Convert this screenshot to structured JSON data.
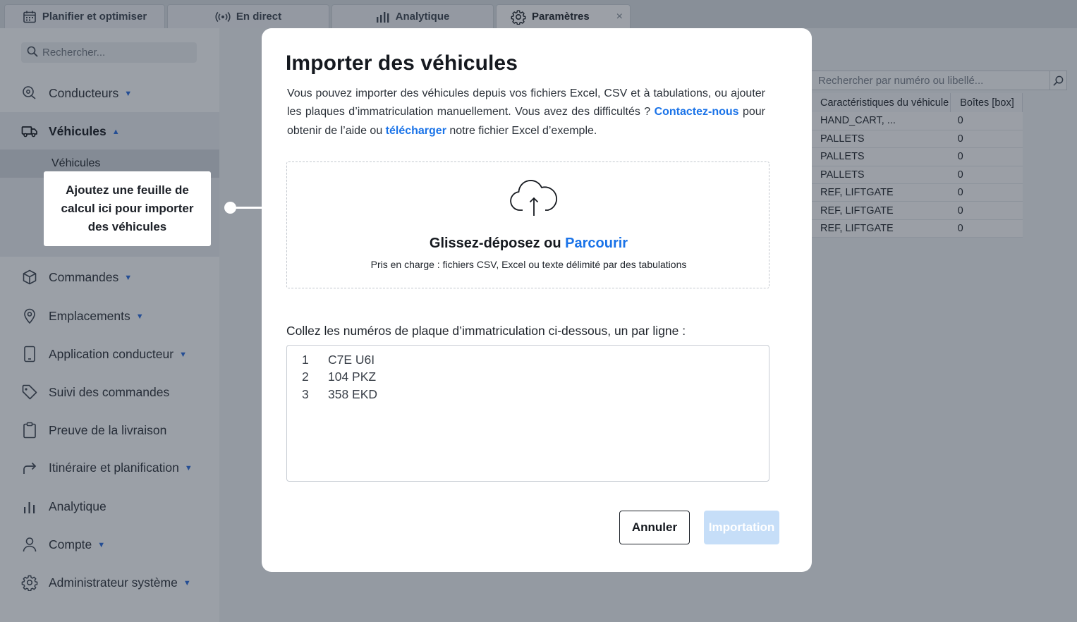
{
  "tabs": [
    {
      "label": "Planifier et optimiser",
      "icon": "calendar-icon"
    },
    {
      "label": "En direct",
      "icon": "live-broadcast-icon"
    },
    {
      "label": "Analytique",
      "icon": "bar-chart-icon"
    },
    {
      "label": "Paramètres",
      "icon": "gear-icon",
      "active": true,
      "close": "×"
    }
  ],
  "sidebar": {
    "search_placeholder": "Rechercher...",
    "items": [
      {
        "label": "Conducteurs",
        "icon": "drivers-icon",
        "caret": "▼"
      },
      {
        "label": "Véhicules",
        "icon": "truck-icon",
        "caret": "▲",
        "expanded": true
      },
      {
        "label": "Commandes",
        "icon": "box-icon",
        "caret": "▼"
      },
      {
        "label": "Emplacements",
        "icon": "location-pin-icon",
        "caret": "▼"
      },
      {
        "label": "Application conducteur",
        "icon": "phone-icon",
        "caret": "▼"
      },
      {
        "label": "Suivi des commandes",
        "icon": "tag-icon"
      },
      {
        "label": "Preuve de la livraison",
        "icon": "clipboard-icon"
      },
      {
        "label": "Itinéraire et planification",
        "icon": "route-arrow-icon",
        "caret": "▼"
      },
      {
        "label": "Analytique",
        "icon": "bar-chart-icon"
      },
      {
        "label": "Compte",
        "icon": "user-icon",
        "caret": "▼"
      },
      {
        "label": "Administrateur système",
        "icon": "gear-icon",
        "caret": "▼"
      }
    ],
    "sub_item": "Véhicules"
  },
  "tooltip": {
    "text": "Ajoutez une feuille de calcul ici pour importer des véhicules"
  },
  "right_panel": {
    "search_placeholder": "Rechercher par numéro ou libellé...",
    "columns": [
      "Caractéristiques du véhicule",
      "Boîtes [box]"
    ],
    "rows": [
      [
        "HAND_CART, ...",
        "0"
      ],
      [
        "PALLETS",
        "0"
      ],
      [
        "PALLETS",
        "0"
      ],
      [
        "PALLETS",
        "0"
      ],
      [
        "REF, LIFTGATE",
        "0"
      ],
      [
        "REF, LIFTGATE",
        "0"
      ],
      [
        "REF, LIFTGATE",
        "0"
      ]
    ]
  },
  "modal": {
    "title": "Importer des véhicules",
    "desc_1": "Vous pouvez importer des véhicules depuis vos fichiers Excel, CSV et à tabulations, ou ajouter les plaques d’immatriculation manuellement. Vous avez des difficultés ? ",
    "contact_link": "Contactez-nous",
    "desc_2": " pour obtenir de l’aide ou ",
    "download_link": "télécharger",
    "desc_3": " notre fichier Excel d’exemple.",
    "dropzone": {
      "title": "Glissez-déposez ou ",
      "browse": "Parcourir",
      "supported": "Pris en charge : fichiers CSV, Excel ou texte délimité par des tabulations"
    },
    "paste_label": "Collez les numéros de plaque d’immatriculation ci-dessous, un par ligne :",
    "plates": [
      {
        "n": "1",
        "value": "C7E U6I"
      },
      {
        "n": "2",
        "value": "104 PKZ"
      },
      {
        "n": "3",
        "value": "358 EKD"
      }
    ],
    "cancel_label": "Annuler",
    "import_label": "Importation"
  },
  "colors": {
    "accent": "#1a73e8",
    "import_disabled": "#c6def8",
    "modal_bg": "#ffffff"
  }
}
